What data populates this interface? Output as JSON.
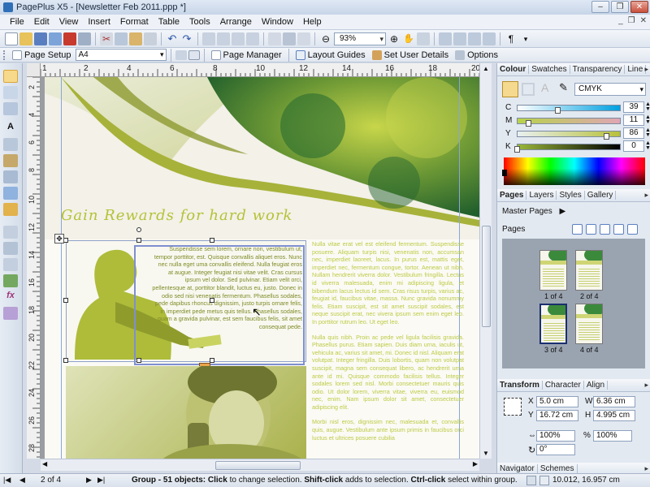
{
  "window": {
    "title": "PagePlus X5 - [Newsletter Feb 2011.ppp *]"
  },
  "menu": [
    "File",
    "Edit",
    "View",
    "Insert",
    "Format",
    "Table",
    "Tools",
    "Arrange",
    "Window",
    "Help"
  ],
  "toolbar": {
    "zoom": "93%"
  },
  "context_toolbar": {
    "page_setup": "Page Setup",
    "page_size": "A4",
    "page_manager": "Page Manager",
    "layout_guides": "Layout Guides",
    "set_user_details": "Set User Details",
    "options": "Options"
  },
  "ruler": {
    "top": [
      "1",
      "2",
      "4",
      "6",
      "8",
      "10",
      "12",
      "14",
      "16",
      "18",
      "20"
    ],
    "left": [
      "2",
      "4",
      "6",
      "8",
      "10",
      "12",
      "14",
      "16",
      "18",
      "20",
      "22",
      "24",
      "26",
      "28"
    ]
  },
  "document": {
    "heading": "Gain Rewards for hard work",
    "float_text": "Suspendisse sem lorem, ornare non, vestibulum ut, tempor porttitor, est. Quisque convallis aliquet eros. Nunc nec nulla eget uma convallis eleifend. Nulla feugiat eros at augue. Integer feugiat nisi vitae velit. Cras cursus ipsum vel dolor. Sed pulvinar. Etiam velit orci, pellentesque at, porttitor blandit, luctus eu, justo. Donec in odio sed nisi venenatis fermentum. Phasellus sodales, pede dapibus rhoncus dignissim, justo turpis ornare felis, in imperdiet pede metus quis tellus. Phasellus sodales, quam a gravida pulvinar, est sem faucibus felis, sit amet consequat pede.",
    "right_col_1": "Nulla vitae erat vel est eleifend fermentum. Suspendisse posuere. Aliquam turpis nisi, venenatis non, accumsan nec, imperdiet laoreet, lacus. In purus est, mattis eget, imperdiet nec, fermentum congue, tortor. Aenean ut nibh. Nullam hendrerit viverra dolor. Vestibulum fringilla. Lectus id viverra malesuada, enim mi adipiscing ligula, et bibendum lacus lectus id sem. Cras risus turpis, varius ac, feugiat id, faucibus vitae, massa. Nunc gravida nonummy felis. Etiam suscipit, est sit amet suscipit sodales, est neque suscipit erat, nec vivera ipsum sem enim eget leo. In porttitor rutrum leo. Ut eget leo.",
    "right_col_2": "Nulla quis nibh. Proin ac pede vel ligula facilisis gravida. Phasellus purus. Etiam sapien. Duis diam urna, iaculis ut, vehicula ac, varius sit amet, mi. Donec id nisl. Aliquam erat volutpat. Integer fringilla. Duis lobortis, quam non volutpat suscipit, magna sem consequat libero, ac hendrerit urna ante id mi. Quisque commodo facilisis tellus. Integer sodales lorem sed nisl. Morbi consectetuer mauris quis odio. Ut dolor lorem, viverra vitae, viverra eu, euismod nec, enim. Nam ipsum dolor sit amet, consectetuer adipiscing elit.",
    "right_col_3": "Morbi nisl eros, dignissim nec, malesuada et, convallis quis, augue. Vestibulum ante ipsum primis in faucibus orci luctus et ultrices posuere cubilia"
  },
  "colour_panel": {
    "tabs": [
      "Colour",
      "Swatches",
      "Transparency",
      "Line"
    ],
    "mode": "CMYK",
    "sliders": [
      {
        "label": "C",
        "value": "39",
        "fraction": 0.39,
        "color_from": "#ffffff",
        "color_to": "#00a0e0"
      },
      {
        "label": "M",
        "value": "11",
        "fraction": 0.11,
        "color_from": "#b8d24a",
        "color_to": "#e0a6b4"
      },
      {
        "label": "Y",
        "value": "86",
        "fraction": 0.86,
        "color_from": "#e8f0f0",
        "color_to": "#b8c03a"
      },
      {
        "label": "K",
        "value": "0",
        "fraction": 0.0,
        "color_from": "#9bb83a",
        "color_to": "#000000"
      }
    ]
  },
  "pages_panel": {
    "tabs": [
      "Pages",
      "Layers",
      "Styles",
      "Gallery"
    ],
    "master_pages": "Master Pages",
    "pages_label": "Pages",
    "thumbs": [
      "1 of 4",
      "2 of 4",
      "3 of 4",
      "4 of 4"
    ]
  },
  "transform_panel": {
    "tabs": [
      "Transform",
      "Character",
      "Align"
    ],
    "x": "5.0 cm",
    "y": "16.72 cm",
    "w": "6.36 cm",
    "h": "4.995 cm",
    "scale_x": "100%",
    "scale_y": "100%",
    "rotate": "0°",
    "x_label": "X",
    "y_label": "Y",
    "w_label": "W",
    "h_label": "H"
  },
  "navigator_panel": {
    "tabs": [
      "Navigator",
      "Schemes"
    ]
  },
  "status": {
    "page": "2 of 4",
    "group": "Group - 51 objects:",
    "click": "Click",
    "click_desc": " to change selection. ",
    "shift_click": "Shift-click",
    "shift_desc": " adds to selection. ",
    "ctrl_click": "Ctrl-click",
    "ctrl_desc": " select within group.",
    "coords": "10.012, 16.957 cm"
  },
  "colors": {
    "accent_green": "#b5c236",
    "dark_green": "#2c7a3a",
    "selection": "#7f8fd0"
  }
}
